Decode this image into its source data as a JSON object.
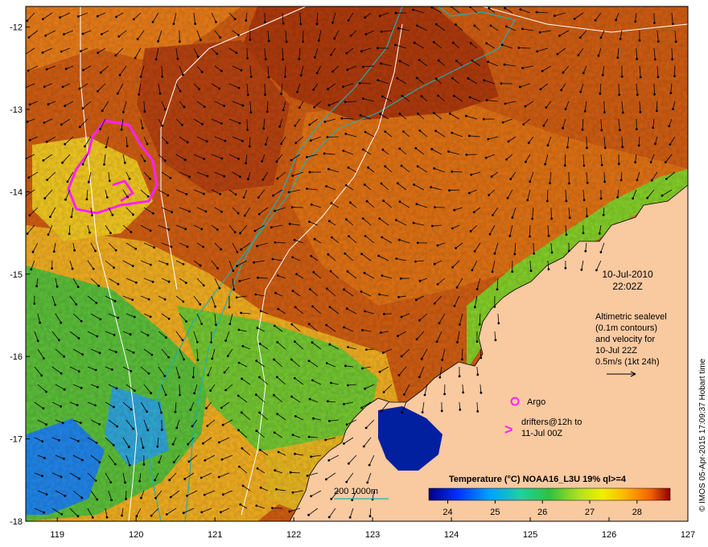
{
  "map": {
    "lon_ticks": [
      "119",
      "120",
      "121",
      "122",
      "123",
      "124",
      "125",
      "126",
      "127"
    ],
    "lat_ticks": [
      "-12",
      "-13",
      "-14",
      "-15",
      "-16",
      "-17",
      "-18"
    ],
    "lon_range": [
      118.6,
      127.0
    ],
    "lat_range": [
      -18.0,
      -11.75
    ]
  },
  "annotations": {
    "date": "10-Jul-2010",
    "time": "22:02Z",
    "altimetry": [
      "Altimetric sealevel",
      "(0.1m contours)",
      "and velocity for",
      "10-Jul 22Z",
      "0.5m/s (1kt 24h)"
    ],
    "argo_label": "Argo",
    "drifter_symbol": ">",
    "drifters": [
      "drifters@12h to",
      "11-Jul 00Z"
    ],
    "bathy": "200 1000m"
  },
  "colorbar": {
    "title": "Temperature (°C) NOAA16_L3U 19% ql>=4",
    "ticks": [
      "24",
      "25",
      "26",
      "27",
      "28"
    ],
    "range": [
      23.6,
      28.7
    ]
  },
  "credit": "© IMOS 05-Apr-2015 17:09:37 Hobart time",
  "colors": {
    "land": "#f9c9a0",
    "hot": "#b8400a",
    "warm": "#e07818",
    "bathy_line": "#20b0b0",
    "drifter": "#ff20ff"
  }
}
